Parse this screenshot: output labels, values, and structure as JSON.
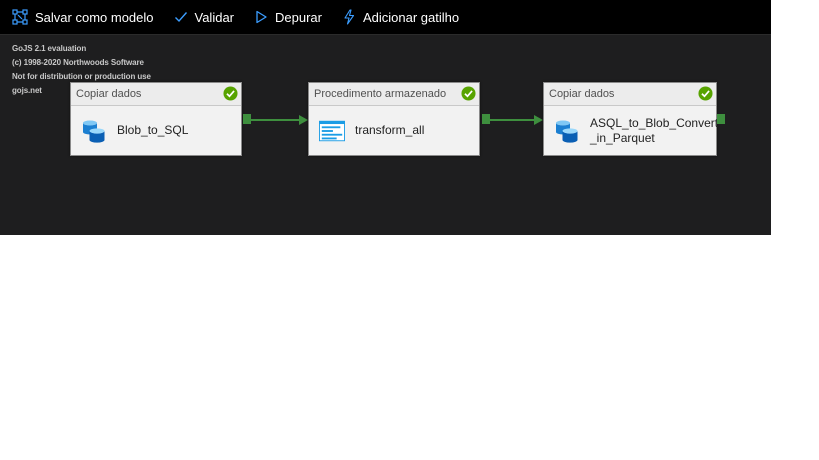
{
  "toolbar": {
    "save_template": "Salvar como modelo",
    "validate": "Validar",
    "debug": "Depurar",
    "add_trigger": "Adicionar gatilho"
  },
  "watermark": {
    "line1": "GoJS 2.1 evaluation",
    "line2": "(c) 1998-2020 Northwoods Software",
    "line3": "Not for distribution or production use",
    "line4": "gojs.net"
  },
  "nodes": [
    {
      "type": "Copiar dados",
      "name": "Blob_to_SQL",
      "icon": "database-icon",
      "status": "success"
    },
    {
      "type": "Procedimento armazenado",
      "name": "transform_all",
      "icon": "stored-procedure-icon",
      "status": "success"
    },
    {
      "type": "Copiar dados",
      "name": "ASQL_to_Blob_Convert_in_Parquet",
      "name_line1": "ASQL_to_Blob_Convert",
      "name_line2": "_in_Parquet",
      "icon": "database-icon",
      "status": "success"
    }
  ],
  "colors": {
    "accent": "#3b9dff",
    "success": "#57a300",
    "link": "#3e8f3e",
    "canvas": "#1e1e1f",
    "toolbar": "#000000"
  }
}
